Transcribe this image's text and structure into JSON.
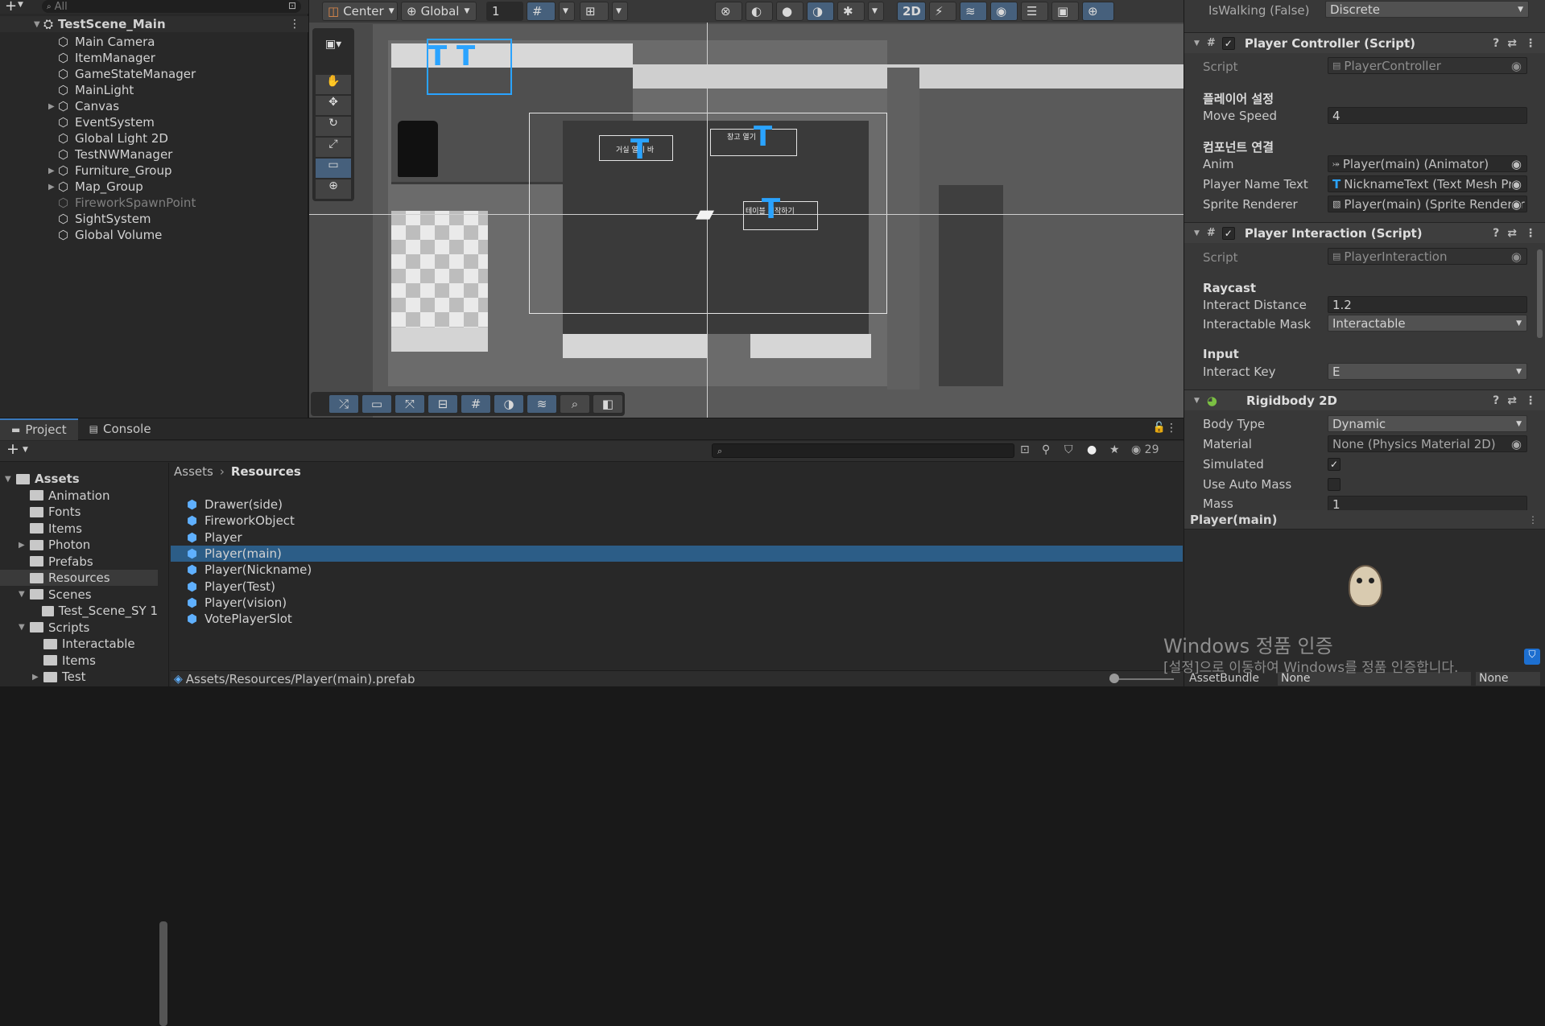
{
  "hierarchy": {
    "search_placeholder": "All",
    "scene_name": "TestScene_Main",
    "items": [
      {
        "label": "Main Camera"
      },
      {
        "label": "ItemManager"
      },
      {
        "label": "GameStateManager"
      },
      {
        "label": "MainLight"
      },
      {
        "label": "Canvas"
      },
      {
        "label": "EventSystem"
      },
      {
        "label": "Global Light 2D"
      },
      {
        "label": "TestNWManager"
      },
      {
        "label": "Furniture_Group"
      },
      {
        "label": "Map_Group"
      },
      {
        "label": "FireworkSpawnPoint"
      },
      {
        "label": "SightSystem"
      },
      {
        "label": "Global Volume"
      }
    ]
  },
  "scene_toolbar": {
    "pivot": "Center",
    "space": "Global",
    "grid_value": "1",
    "mode_2d": "2D"
  },
  "scene": {
    "labels": [
      "거실 열기 바",
      "창고 열기",
      "테이블 시작하기"
    ]
  },
  "inspector": {
    "top_label": "IsWalking (False)",
    "top_value": "Discrete",
    "pc": {
      "title": "Player Controller (Script)",
      "script_label": "Script",
      "script_value": "PlayerController",
      "section1": "플레이어 설정",
      "move_speed_label": "Move Speed",
      "move_speed_value": "4",
      "section2": "컴포넌트 연결",
      "anim_label": "Anim",
      "anim_value": "Player(main) (Animator)",
      "name_text_label": "Player Name Text",
      "name_text_value": "NicknameText (Text Mesh Pro",
      "sprite_label": "Sprite Renderer",
      "sprite_value": "Player(main) (Sprite Renderer"
    },
    "pi": {
      "title": "Player Interaction (Script)",
      "script_label": "Script",
      "script_value": "PlayerInteraction",
      "raycast": "Raycast",
      "dist_label": "Interact Distance",
      "dist_value": "1.2",
      "mask_label": "Interactable Mask",
      "mask_value": "Interactable",
      "input": "Input",
      "key_label": "Interact Key",
      "key_value": "E"
    },
    "rb": {
      "title": "Rigidbody 2D",
      "body_type_label": "Body Type",
      "body_type_value": "Dynamic",
      "material_label": "Material",
      "material_value": "None (Physics Material 2D)",
      "simulated_label": "Simulated",
      "auto_mass_label": "Use Auto Mass",
      "mass_label": "Mass",
      "mass_value": "1"
    }
  },
  "preview": {
    "title": "Player(main)",
    "bundle_label": "AssetBundle",
    "bundle_value": "None",
    "variant_value": "None"
  },
  "watermark": {
    "title": "Windows 정품 인증",
    "subtitle": "[설정]으로 이동하여 Windows를 정품 인증합니다."
  },
  "project": {
    "tab_project": "Project",
    "tab_console": "Console",
    "hidden_count": "29",
    "breadcrumb_root": "Assets",
    "breadcrumb_current": "Resources",
    "footer_path": "Assets/Resources/Player(main).prefab",
    "tree": [
      {
        "label": "Assets"
      },
      {
        "label": "Animation"
      },
      {
        "label": "Fonts"
      },
      {
        "label": "Items"
      },
      {
        "label": "Photon"
      },
      {
        "label": "Prefabs"
      },
      {
        "label": "Resources"
      },
      {
        "label": "Scenes"
      },
      {
        "label": "Test_Scene_SY 1"
      },
      {
        "label": "Scripts"
      },
      {
        "label": "Interactable"
      },
      {
        "label": "Items"
      },
      {
        "label": "Test"
      }
    ],
    "assets": [
      {
        "label": "Drawer(side)"
      },
      {
        "label": "FireworkObject"
      },
      {
        "label": "Player"
      },
      {
        "label": "Player(main)"
      },
      {
        "label": "Player(Nickname)"
      },
      {
        "label": "Player(Test)"
      },
      {
        "label": "Player(vision)"
      },
      {
        "label": "VotePlayerSlot"
      }
    ]
  }
}
